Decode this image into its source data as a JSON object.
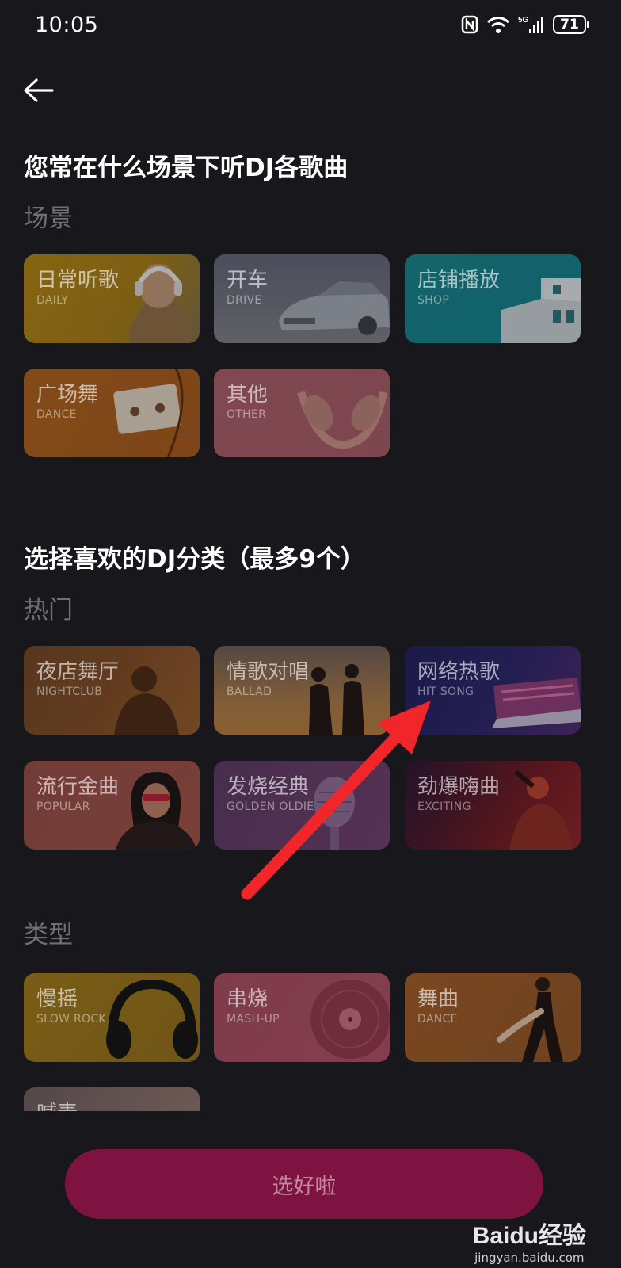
{
  "status": {
    "time": "10:05",
    "battery": "71",
    "network": "5G"
  },
  "scene_section": {
    "title": "您常在什么场景下听DJ各歌曲",
    "subheading": "场景",
    "tiles": [
      {
        "label": "日常听歌",
        "sub": "DAILY"
      },
      {
        "label": "开车",
        "sub": "DRIVE"
      },
      {
        "label": "店铺播放",
        "sub": "SHOP"
      },
      {
        "label": "广场舞",
        "sub": "DANCE"
      },
      {
        "label": "其他",
        "sub": "OTHER"
      }
    ]
  },
  "category_section": {
    "title": "选择喜欢的DJ分类（最多9个）",
    "hot_heading": "热门",
    "hot_tiles": [
      {
        "label": "夜店舞厅",
        "sub": "NIGHTCLUB"
      },
      {
        "label": "情歌对唱",
        "sub": "BALLAD"
      },
      {
        "label": "网络热歌",
        "sub": "HIT SONG"
      },
      {
        "label": "流行金曲",
        "sub": "POPULAR"
      },
      {
        "label": "发烧经典",
        "sub": "GOLDEN OLDIE"
      },
      {
        "label": "劲爆嗨曲",
        "sub": "EXCITING"
      }
    ],
    "type_heading": "类型",
    "type_tiles": [
      {
        "label": "慢摇",
        "sub": "SLOW ROCK"
      },
      {
        "label": "串烧",
        "sub": "MASH-UP"
      },
      {
        "label": "舞曲",
        "sub": "DANCE"
      },
      {
        "label": "喊麦",
        "sub": ""
      }
    ]
  },
  "confirm_button": "选好啦",
  "watermark": {
    "brand": "Baidu经验",
    "url": "jingyan.baidu.com"
  },
  "colors": {
    "background": "#17171c",
    "button": "#7e1240",
    "annotation_arrow": "#f0262a"
  }
}
